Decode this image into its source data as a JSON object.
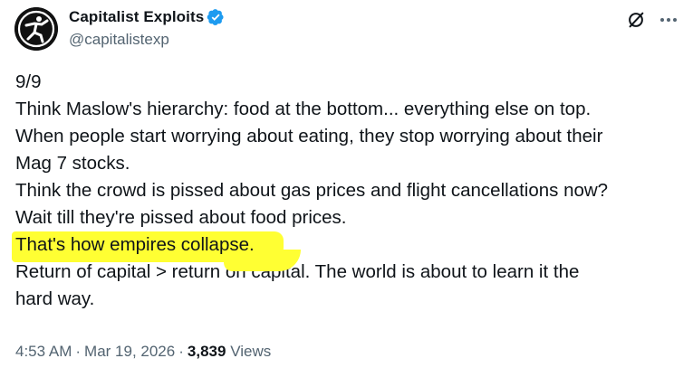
{
  "author": {
    "display_name": "Capitalist Exploits",
    "handle": "@capitalistexp",
    "verified": true
  },
  "icons": {
    "avatar": "running-figure-logo",
    "verified": "verified-badge-icon",
    "grok": "grok-slash-circle-icon",
    "more": "more-horizontal-icon"
  },
  "colors": {
    "verified_blue": "#1d9bf0",
    "highlight_yellow": "#ffff33",
    "secondary_text": "#536471"
  },
  "tweet": {
    "lines": [
      "9/9",
      "Think Maslow's hierarchy: food at the bottom... everything else on top.",
      "When people start worrying about eating, they stop worrying about their",
      "Mag 7 stocks.",
      "Think the crowd is pissed about gas prices and flight cancellations now?",
      "Wait till they're pissed about food prices.",
      "That's how empires collapse.",
      "Return of capital > return on capital. The world is about to learn it the",
      "hard way."
    ],
    "highlighted_line_index": 6
  },
  "meta": {
    "time": "4:53 AM",
    "date": "Mar 19, 2026",
    "separator": "·",
    "views_count": "3,839",
    "views_label": "Views"
  }
}
